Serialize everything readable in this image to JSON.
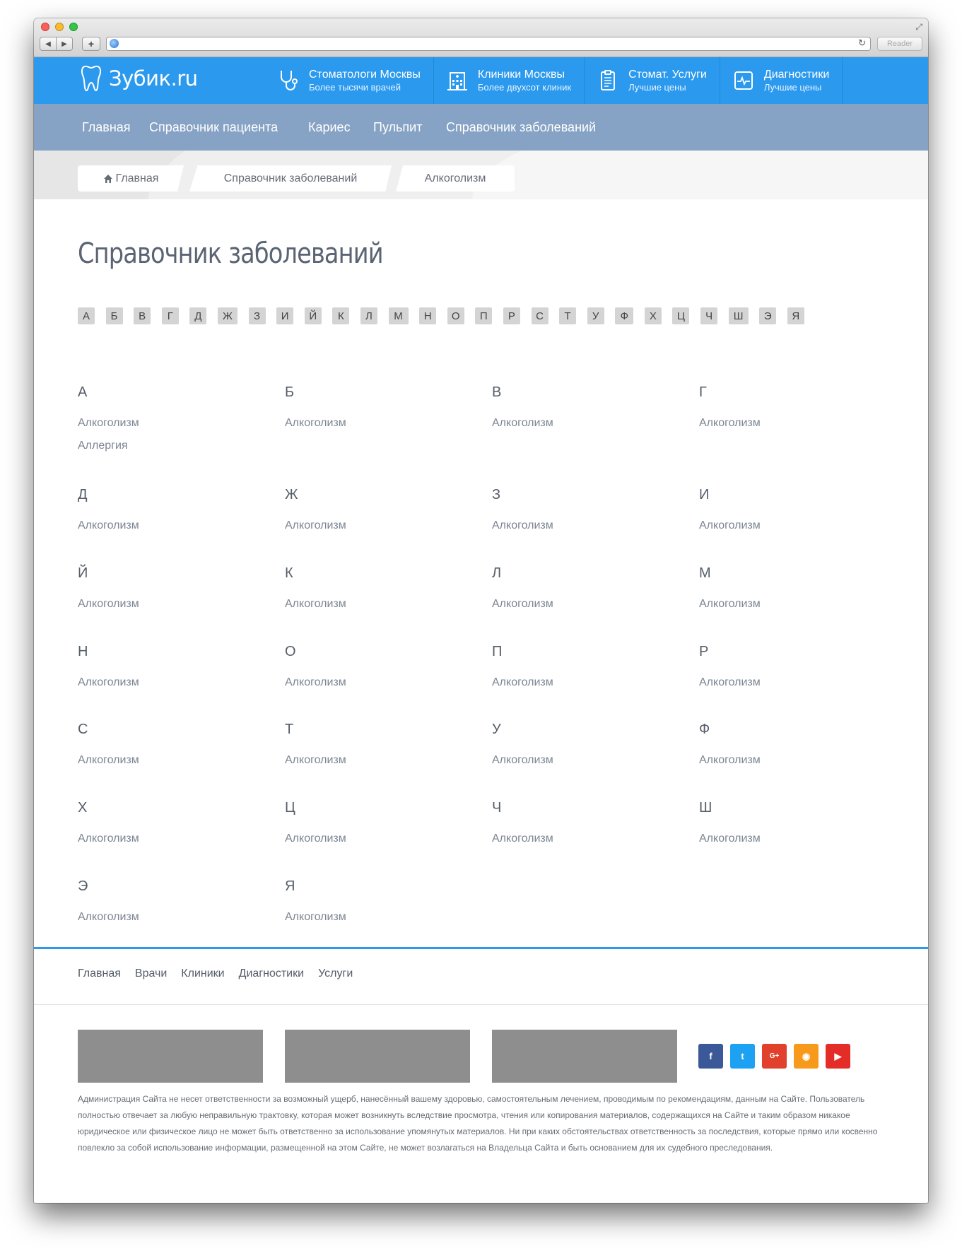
{
  "browser": {
    "reader_label": "Reader"
  },
  "header": {
    "logo": "Зубик.ru",
    "nav": [
      {
        "icon": "stethoscope-icon",
        "title": "Стоматологи Москвы",
        "subtitle": "Более тысячи врачей"
      },
      {
        "icon": "hospital-icon",
        "title": "Клиники Москвы",
        "subtitle": "Более двухсот клиник"
      },
      {
        "icon": "clipboard-icon",
        "title": "Стомат. Услуги",
        "subtitle": "Лучшие цены"
      },
      {
        "icon": "monitor-icon",
        "title": "Диагностики",
        "subtitle": "Лучшие цены"
      }
    ],
    "color": "#2a99ee"
  },
  "subnav": [
    "Главная",
    "Справочник пациента",
    "Кариес",
    "Пульпит",
    "Справочник заболеваний"
  ],
  "breadcrumb": [
    "Главная",
    "Справочник заболеваний",
    "Алкоголизм"
  ],
  "main": {
    "title": "Справочник заболеваний",
    "alphabet": [
      "А",
      "Б",
      "В",
      "Г",
      "Д",
      "Ж",
      "З",
      "И",
      "Й",
      "К",
      "Л",
      "М",
      "Н",
      "О",
      "П",
      "Р",
      "С",
      "Т",
      "У",
      "Ф",
      "Х",
      "Ц",
      "Ч",
      "Ш",
      "Э",
      "Я"
    ],
    "groups": [
      {
        "letter": "А",
        "items": [
          "Алкоголизм",
          "Аллергия"
        ]
      },
      {
        "letter": "Б",
        "items": [
          "Алкоголизм"
        ]
      },
      {
        "letter": "В",
        "items": [
          "Алкоголизм"
        ]
      },
      {
        "letter": "Г",
        "items": [
          "Алкоголизм"
        ]
      },
      {
        "letter": "Д",
        "items": [
          "Алкоголизм"
        ]
      },
      {
        "letter": "Ж",
        "items": [
          "Алкоголизм"
        ]
      },
      {
        "letter": "З",
        "items": [
          "Алкоголизм"
        ]
      },
      {
        "letter": "И",
        "items": [
          "Алкоголизм"
        ]
      },
      {
        "letter": "Й",
        "items": [
          "Алкоголизм"
        ]
      },
      {
        "letter": "К",
        "items": [
          "Алкоголизм"
        ]
      },
      {
        "letter": "Л",
        "items": [
          "Алкоголизм"
        ]
      },
      {
        "letter": "М",
        "items": [
          "Алкоголизм"
        ]
      },
      {
        "letter": "Н",
        "items": [
          "Алкоголизм"
        ]
      },
      {
        "letter": "О",
        "items": [
          "Алкоголизм"
        ]
      },
      {
        "letter": "П",
        "items": [
          "Алкоголизм"
        ]
      },
      {
        "letter": "Р",
        "items": [
          "Алкоголизм"
        ]
      },
      {
        "letter": "С",
        "items": [
          "Алкоголизм"
        ]
      },
      {
        "letter": "Т",
        "items": [
          "Алкоголизм"
        ]
      },
      {
        "letter": "У",
        "items": [
          "Алкоголизм"
        ]
      },
      {
        "letter": "Ф",
        "items": [
          "Алкоголизм"
        ]
      },
      {
        "letter": "Х",
        "items": [
          "Алкоголизм"
        ]
      },
      {
        "letter": "Ц",
        "items": [
          "Алкоголизм"
        ]
      },
      {
        "letter": "Ч",
        "items": [
          "Алкоголизм"
        ]
      },
      {
        "letter": "Ш",
        "items": [
          "Алкоголизм"
        ]
      },
      {
        "letter": "Э",
        "items": [
          "Алкоголизм"
        ]
      },
      {
        "letter": "Я",
        "items": [
          "Алкоголизм"
        ]
      }
    ]
  },
  "footer": {
    "nav": [
      "Главная",
      "Врачи",
      "Клиники",
      "Диагностики",
      "Услуги"
    ],
    "social": [
      {
        "icon": "facebook-icon",
        "glyph": "f",
        "color": "#3b5998"
      },
      {
        "icon": "twitter-icon",
        "glyph": "t",
        "color": "#1da1f2"
      },
      {
        "icon": "google-plus-icon",
        "glyph": "G+",
        "color": "#e0402c"
      },
      {
        "icon": "rss-icon",
        "glyph": "◉",
        "color": "#f79a1c"
      },
      {
        "icon": "youtube-icon",
        "glyph": "▶",
        "color": "#e52d27"
      }
    ],
    "disclaimer": "Администрация Сайта не несет ответственности за возможный ущерб, нанесённый вашему здоровью, самостоятельным лечением, проводимым по рекомендациям, данным на Сайте. Пользователь полностью отвечает за любую неправильную трактовку, которая может возникнуть вследствие просмотра, чтения или копирования материалов, содержащихся на Сайте и таким образом никакое юридическое или физическое лицо не может быть ответственно за использование упомянутых материалов. Ни при каких обстоятельствах ответственность за последствия, которые прямо или косвенно повлекло за собой использование информации, размещенной на этом Сайте, не может возлагаться на Владельца Сайта и быть основанием для их судебного преследования."
  }
}
